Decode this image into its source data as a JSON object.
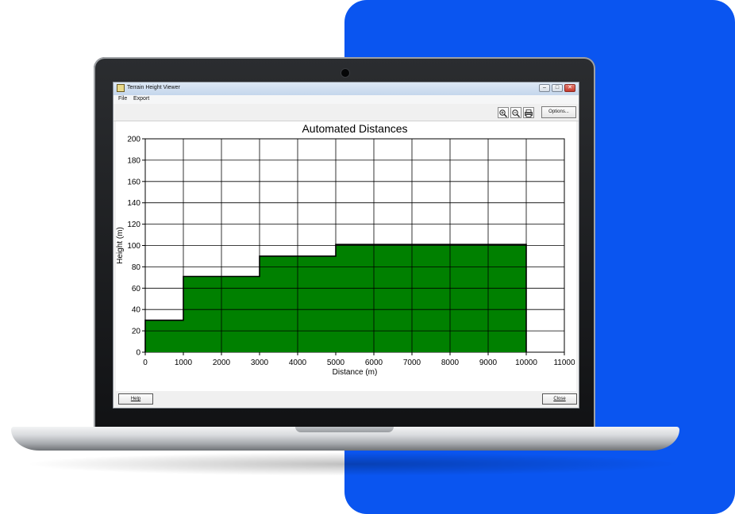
{
  "window": {
    "title": "Terrain Height Viewer",
    "controls": {
      "minimize": "‒",
      "restore": "□",
      "close": "✕"
    }
  },
  "menu": [
    {
      "label": "File"
    },
    {
      "label": "Export"
    }
  ],
  "toolbar": {
    "icons": [
      "zoom-in-icon",
      "zoom-out-icon",
      "print-icon"
    ],
    "options_label": "Options..."
  },
  "buttons": {
    "help_label": "Help",
    "close_label": "Close"
  },
  "colors": {
    "background_accent": "#0a55f0",
    "bar_fill": "#008000",
    "bar_stroke": "#000000"
  },
  "chart_data": {
    "type": "area",
    "title": "Automated Distances",
    "xlabel": "Distance (m)",
    "ylabel": "Height (m)",
    "xlim": [
      0,
      11000
    ],
    "ylim": [
      0,
      200
    ],
    "xticks": [
      0,
      1000,
      2000,
      3000,
      4000,
      5000,
      6000,
      7000,
      8000,
      9000,
      10000,
      11000
    ],
    "yticks": [
      0,
      20,
      40,
      60,
      80,
      100,
      120,
      140,
      160,
      180,
      200
    ],
    "grid": true,
    "series": [
      {
        "steps": [
          {
            "x0": 0,
            "x1": 1000,
            "y": 30
          },
          {
            "x0": 1000,
            "x1": 3000,
            "y": 71
          },
          {
            "x0": 3000,
            "x1": 5000,
            "y": 90
          },
          {
            "x0": 5000,
            "x1": 10000,
            "y": 101
          }
        ]
      }
    ]
  }
}
